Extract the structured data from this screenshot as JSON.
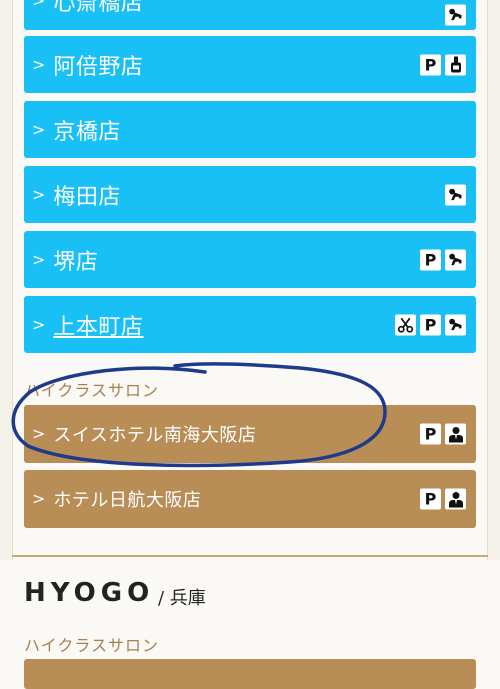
{
  "osaka_stores": [
    {
      "name": "心斎橋店",
      "icons": [
        "baby-icon"
      ]
    },
    {
      "name": "阿倍野店",
      "icons": [
        "parking-icon",
        "nail-polish-icon"
      ]
    },
    {
      "name": "京橋店",
      "icons": []
    },
    {
      "name": "梅田店",
      "icons": [
        "baby-icon"
      ]
    },
    {
      "name": "堺店",
      "icons": [
        "parking-icon",
        "baby-icon"
      ]
    },
    {
      "name": "上本町店",
      "icons": [
        "scissors-icon",
        "parking-icon",
        "baby-icon"
      ]
    }
  ],
  "high_class": {
    "label": "ハイクラスサロン",
    "stores": [
      {
        "name": "スイスホテル南海大阪店",
        "icons": [
          "parking-icon",
          "staff-icon"
        ]
      },
      {
        "name": "ホテル日航大阪店",
        "icons": [
          "parking-icon",
          "staff-icon"
        ]
      }
    ]
  },
  "hyogo": {
    "region": "HYOGO",
    "region_ja": "/ 兵庫",
    "section_label": "ハイクラスサロン"
  },
  "parking_text": "P",
  "chevron": ">",
  "colors": {
    "store_button": "#18c0f6",
    "high_class_button": "#b98d56",
    "section_text": "#a8804c",
    "annotation_ink": "#1e3a8a"
  }
}
